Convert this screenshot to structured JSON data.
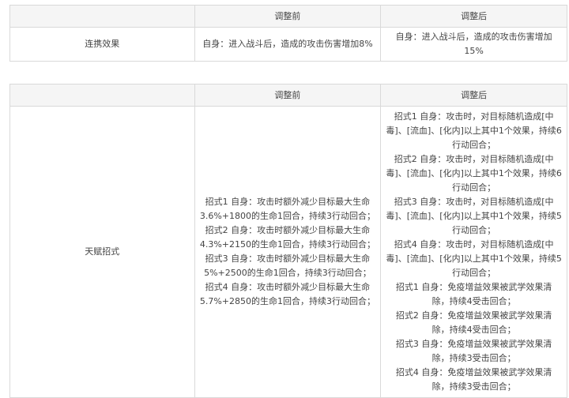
{
  "table1": {
    "header": [
      "",
      "调整前",
      "调整后"
    ],
    "row": {
      "label": "连携效果",
      "before": "自身：进入战斗后，造成的攻击伤害增加8%",
      "after_lines": [
        "自身：进入战斗后，造成的攻击伤害增加",
        "15%"
      ]
    }
  },
  "table2": {
    "header": [
      "",
      "调整前",
      "调整后"
    ],
    "row": {
      "label": "天赋招式",
      "before_lines": [
        "招式1 自身：攻击时额外减少目标最大生命",
        "3.6%+1800的生命1回合，持续3行动回合；",
        "招式2 自身：攻击时额外减少目标最大生命",
        "4.3%+2150的生命1回合，持续3行动回合；",
        "招式3 自身：攻击时额外减少目标最大生命",
        "5%+2500的生命1回合，持续3行动回合；",
        "招式4 自身：攻击时额外减少目标最大生命",
        "5.7%+2850的生命1回合，持续3行动回合；"
      ],
      "after_lines": [
        "招式1 自身：攻击时，对目标随机造成[中",
        "毒]、[流血]、[化内]以上其中1个效果，持续6",
        "行动回合；",
        "招式2 自身：攻击时，对目标随机造成[中",
        "毒]、[流血]、[化内]以上其中1个效果，持续6",
        "行动回合；",
        "招式3 自身：攻击时，对目标随机造成[中",
        "毒]、[流血]、[化内]以上其中1个效果，持续5",
        "行动回合；",
        "招式4 自身：攻击时，对目标随机造成[中",
        "毒]、[流血]、[化内]以上其中1个效果，持续5",
        "行动回合；",
        "招式1 自身：免疫增益效果被武学效果清",
        "除，持续4受击回合；",
        "招式2 自身：免疫增益效果被武学效果清",
        "除，持续4受击回合；",
        "招式3 自身：免疫增益效果被武学效果清",
        "除，持续3受击回合；",
        "招式4 自身：免疫增益效果被武学效果清",
        "除，持续3受击回合；"
      ]
    }
  }
}
